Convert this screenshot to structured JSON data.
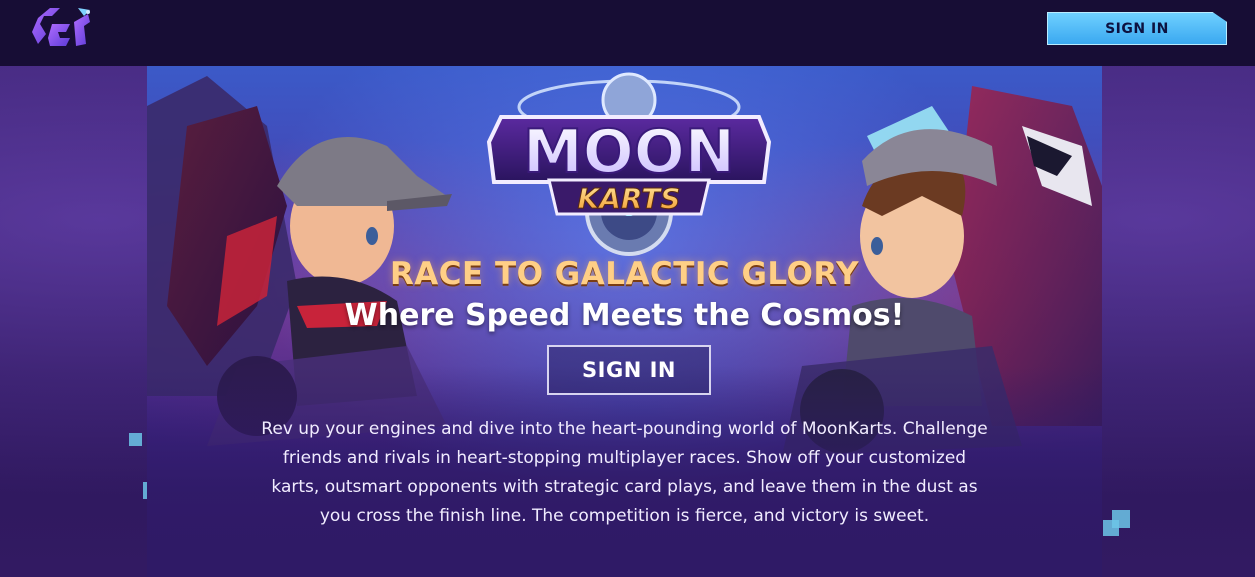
{
  "header": {
    "logo_icon": "brand-logo-icon",
    "signin_label": "SIGN IN"
  },
  "hero": {
    "game_logo": {
      "line1": "MOON",
      "line2": "KARTS"
    },
    "tagline": "RACE TO GALACTIC GLORY",
    "subtitle": "Where Speed Meets the Cosmos!",
    "signin_label": "SIGN IN",
    "description": "Rev up your engines and dive into the heart-pounding world of MoonKarts. Challenge friends and rivals in heart-stopping multiplayer races. Show off your customized karts, outsmart opponents with strategic card plays, and leave them in the dust as you cross the finish line. The competition is fierce, and victory is sweet."
  },
  "colors": {
    "topbar_bg": "#170d35",
    "accent_button": "#4ab4f2",
    "tagline_gold": "#ffcf86",
    "page_bg": "#2a1650"
  }
}
